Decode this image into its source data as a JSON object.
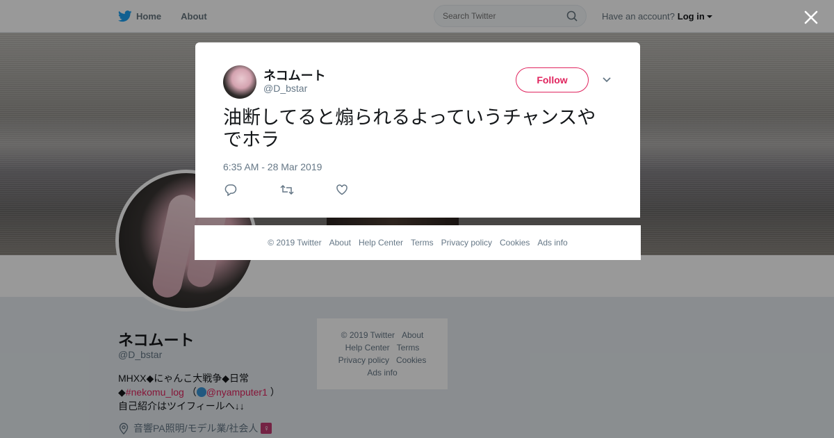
{
  "nav": {
    "home": "Home",
    "about": "About",
    "search_placeholder": "Search Twitter",
    "account_prompt": "Have an account?",
    "login": "Log in"
  },
  "profile": {
    "name": "ネコムート",
    "handle": "@D_bstar",
    "bio_line1": "MHXX◆にゃんこ大戦争◆日常",
    "bio_line2_prefix": "◆",
    "bio_hashtag": "#nekomu_log",
    "bio_paren_open": "（",
    "bio_mention": "@nyamputer1",
    "bio_paren_close": "）",
    "bio_line3": "自己紹介はツイフィールへ↓↓",
    "location": "音響PA照明/モデル業/社会人"
  },
  "side_footer": {
    "copyright": "© 2019 Twitter",
    "about": "About",
    "help": "Help Center",
    "terms": "Terms",
    "privacy": "Privacy policy",
    "cookies": "Cookies",
    "ads": "Ads info"
  },
  "tweet": {
    "author_name": "ネコムート",
    "author_handle": "@D_bstar",
    "follow_label": "Follow",
    "text": "油断してると煽られるよっていうチャンスやでホラ",
    "timestamp": "6:35 AM - 28 Mar 2019"
  },
  "footer": {
    "copyright": "© 2019 Twitter",
    "about": "About",
    "help": "Help Center",
    "terms": "Terms",
    "privacy": "Privacy policy",
    "cookies": "Cookies",
    "ads": "Ads info"
  },
  "colors": {
    "brand": "#1da1f2",
    "accent": "#e0245e",
    "muted": "#657786"
  }
}
